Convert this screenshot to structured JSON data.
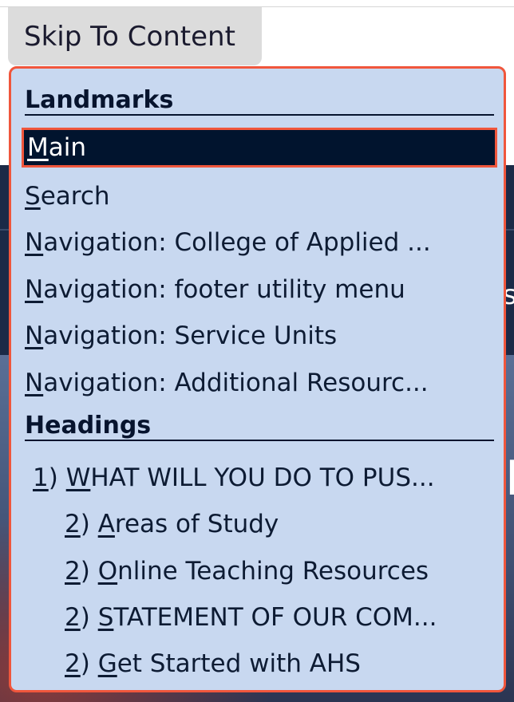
{
  "skip_link": {
    "label": "Skip To Content"
  },
  "menu": {
    "landmarks_title": "Landmarks",
    "landmarks": [
      {
        "key": "M",
        "rest": "ain",
        "active": true
      },
      {
        "key": "S",
        "rest": "earch"
      },
      {
        "key": "N",
        "rest": "avigation: College of Applied ..."
      },
      {
        "key": "N",
        "rest": "avigation: footer utility menu"
      },
      {
        "key": "N",
        "rest": "avigation: Service Units"
      },
      {
        "key": "N",
        "rest": "avigation: Additional Resourc..."
      }
    ],
    "headings_title": "Headings",
    "headings": [
      {
        "level": "1",
        "key": "W",
        "rest": "HAT WILL YOU DO TO PUS..."
      },
      {
        "level": "2",
        "key": "A",
        "rest": "reas of Study"
      },
      {
        "level": "2",
        "key": "O",
        "rest": "nline Teaching Resources"
      },
      {
        "level": "2",
        "key": "S",
        "rest": "TATEMENT OF OUR COM..."
      },
      {
        "level": "2",
        "key": "G",
        "rest": "et Started with AHS"
      }
    ]
  },
  "colors": {
    "menu_bg": "#c8d8f0",
    "focus_border": "#f0563c",
    "active_bg": "#01142e",
    "text": "#0d1b33"
  }
}
